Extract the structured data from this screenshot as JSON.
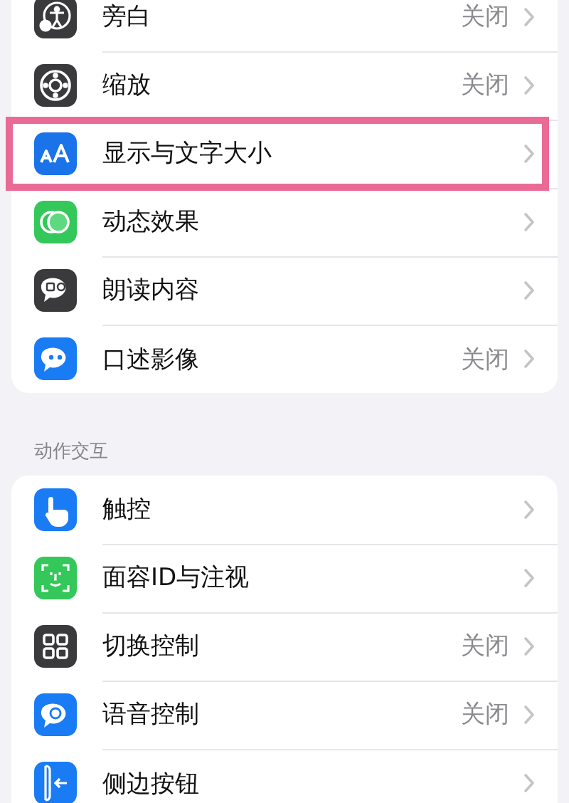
{
  "sections": [
    {
      "items": [
        {
          "label": "旁白",
          "value": "关闭",
          "highlighted": false
        },
        {
          "label": "缩放",
          "value": "关闭",
          "highlighted": false
        },
        {
          "label": "显示与文字大小",
          "highlighted": true
        },
        {
          "label": "动态效果",
          "highlighted": false
        },
        {
          "label": "朗读内容",
          "highlighted": false
        },
        {
          "label": "口述影像",
          "value": "关闭",
          "highlighted": false
        }
      ]
    },
    {
      "header": "动作交互",
      "items": [
        {
          "label": "触控",
          "highlighted": false
        },
        {
          "label": "面容ID与注视",
          "highlighted": false
        },
        {
          "label": "切换控制",
          "value": "关闭",
          "highlighted": false
        },
        {
          "label": "语音控制",
          "value": "关闭",
          "highlighted": false
        },
        {
          "label": "侧边按钮",
          "highlighted": false
        }
      ]
    }
  ]
}
